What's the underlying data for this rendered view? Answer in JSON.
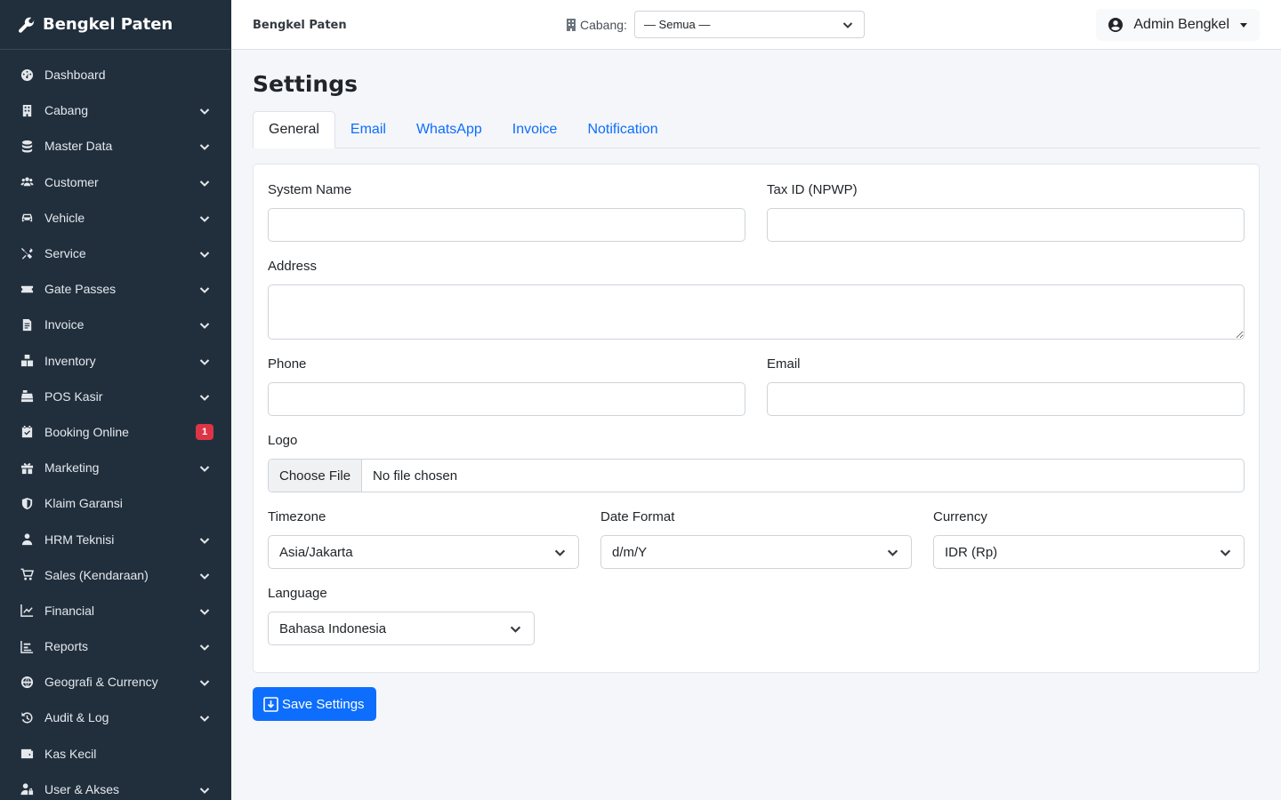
{
  "brand": {
    "name": "Bengkel Paten"
  },
  "sidebar": {
    "items": [
      {
        "label": "Dashboard",
        "icon": "gauge-icon",
        "chevron": false
      },
      {
        "label": "Cabang",
        "icon": "building-icon",
        "chevron": true
      },
      {
        "label": "Master Data",
        "icon": "database-icon",
        "chevron": true
      },
      {
        "label": "Customer",
        "icon": "users-icon",
        "chevron": true
      },
      {
        "label": "Vehicle",
        "icon": "car-icon",
        "chevron": true
      },
      {
        "label": "Service",
        "icon": "tools-icon",
        "chevron": true
      },
      {
        "label": "Gate Passes",
        "icon": "ticket-icon",
        "chevron": true
      },
      {
        "label": "Invoice",
        "icon": "file-invoice-icon",
        "chevron": true
      },
      {
        "label": "Inventory",
        "icon": "boxes-icon",
        "chevron": true
      },
      {
        "label": "POS Kasir",
        "icon": "cash-register-icon",
        "chevron": true
      },
      {
        "label": "Booking Online",
        "icon": "calendar-check-icon",
        "chevron": false,
        "badge": "1"
      },
      {
        "label": "Marketing",
        "icon": "gift-icon",
        "chevron": true
      },
      {
        "label": "Klaim Garansi",
        "icon": "shield-icon",
        "chevron": false
      },
      {
        "label": "HRM Teknisi",
        "icon": "user-tie-icon",
        "chevron": true
      },
      {
        "label": "Sales (Kendaraan)",
        "icon": "cart-icon",
        "chevron": true
      },
      {
        "label": "Financial",
        "icon": "chart-line-icon",
        "chevron": true
      },
      {
        "label": "Reports",
        "icon": "chart-bar-icon",
        "chevron": true
      },
      {
        "label": "Geografi & Currency",
        "icon": "globe-icon",
        "chevron": true
      },
      {
        "label": "Audit & Log",
        "icon": "history-icon",
        "chevron": true
      },
      {
        "label": "Kas Kecil",
        "icon": "wallet-icon",
        "chevron": false
      },
      {
        "label": "User & Akses",
        "icon": "user-lock-icon",
        "chevron": true
      }
    ]
  },
  "topbar": {
    "title": "Bengkel Paten",
    "branch_label": "Cabang:",
    "branch_value": "— Semua —",
    "user_name": "Admin Bengkel"
  },
  "page": {
    "title": "Settings",
    "tabs": [
      {
        "label": "General",
        "active": true
      },
      {
        "label": "Email",
        "active": false
      },
      {
        "label": "WhatsApp",
        "active": false
      },
      {
        "label": "Invoice",
        "active": false
      },
      {
        "label": "Notification",
        "active": false
      }
    ]
  },
  "form": {
    "system_name": {
      "label": "System Name",
      "value": ""
    },
    "tax_id": {
      "label": "Tax ID (NPWP)",
      "value": ""
    },
    "address": {
      "label": "Address",
      "value": ""
    },
    "phone": {
      "label": "Phone",
      "value": ""
    },
    "email": {
      "label": "Email",
      "value": ""
    },
    "logo": {
      "label": "Logo",
      "button": "Choose File",
      "status": "No file chosen"
    },
    "timezone": {
      "label": "Timezone",
      "value": "Asia/Jakarta"
    },
    "date_format": {
      "label": "Date Format",
      "value": "d/m/Y"
    },
    "currency": {
      "label": "Currency",
      "value": "IDR (Rp)"
    },
    "language": {
      "label": "Language",
      "value": "Bahasa Indonesia"
    },
    "save_label": "Save Settings"
  },
  "colors": {
    "sidebar_bg": "#212f3d",
    "accent": "#0d6efd",
    "badge": "#dc3545",
    "content_bg": "#f4f6f9"
  }
}
